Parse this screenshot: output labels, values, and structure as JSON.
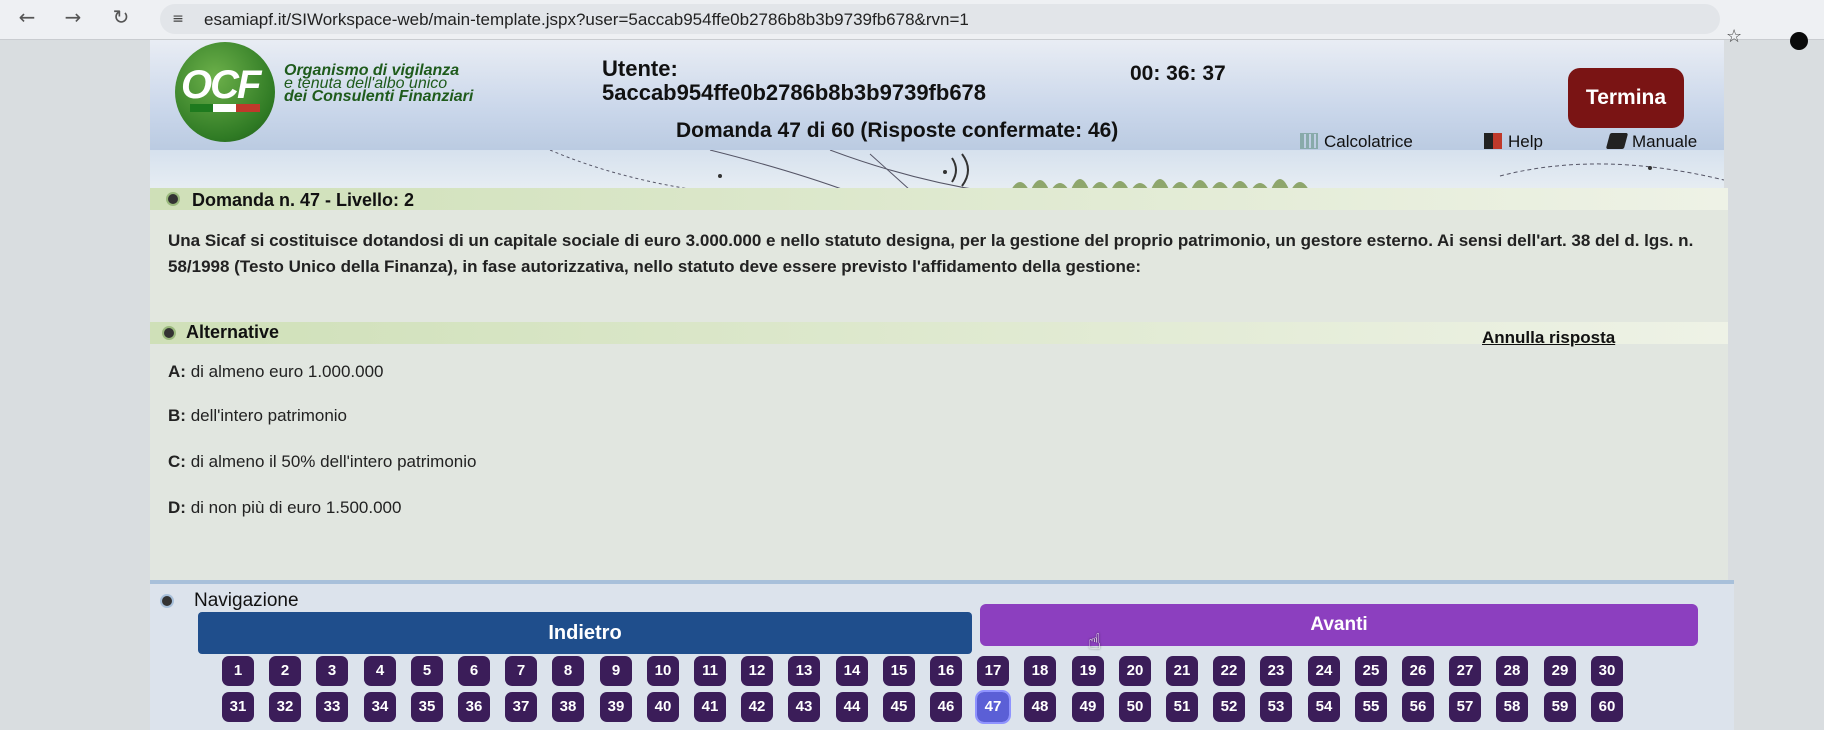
{
  "browser": {
    "url": "esamiapf.it/SIWorkspace-web/main-template.jspx?user=5accab954ffe0b2786b8b3b9739fb678&rvn=1"
  },
  "header": {
    "logo_text": "OCF",
    "org_line1": "Organismo di vigilanza",
    "org_line2": "e tenuta dell'albo unico",
    "org_line3": "dei Consulenti Finanziari",
    "user_label": "Utente:",
    "user_id": "5accab954ffe0b2786b8b3b9739fb678",
    "timer": "00: 36: 37",
    "question_status": "Domanda 47 di 60 (Risposte confermate: 46)",
    "terminate_label": "Termina",
    "tools": {
      "calculator": "Calcolatrice",
      "help": "Help",
      "manual": "Manuale"
    }
  },
  "question": {
    "title": "Domanda n. 47 - Livello: 2",
    "text": "Una Sicaf si costituisce dotandosi di un capitale sociale di euro 3.000.000 e nello statuto designa, per la gestione del proprio patrimonio, un gestore esterno. Ai sensi dell'art. 38 del d. lgs. n. 58/1998 (Testo Unico della Finanza), in fase autorizzativa, nello statuto deve essere previsto l'affidamento della gestione:"
  },
  "alternatives": {
    "title": "Alternative",
    "cancel_label": "Annulla risposta",
    "options": [
      {
        "letter": "A:",
        "text": "di almeno euro 1.000.000"
      },
      {
        "letter": "B:",
        "text": "dell'intero patrimonio"
      },
      {
        "letter": "C:",
        "text": "di almeno il 50% dell'intero patrimonio"
      },
      {
        "letter": "D:",
        "text": "di non più di euro 1.500.000"
      }
    ]
  },
  "navigation": {
    "title": "Navigazione",
    "back_label": "Indietro",
    "next_label": "Avanti",
    "current_question": "47",
    "question_numbers": [
      "1",
      "2",
      "3",
      "4",
      "5",
      "6",
      "7",
      "8",
      "9",
      "10",
      "11",
      "12",
      "13",
      "14",
      "15",
      "16",
      "17",
      "18",
      "19",
      "20",
      "21",
      "22",
      "23",
      "24",
      "25",
      "26",
      "27",
      "28",
      "29",
      "30",
      "31",
      "32",
      "33",
      "34",
      "35",
      "36",
      "37",
      "38",
      "39",
      "40",
      "41",
      "42",
      "43",
      "44",
      "45",
      "46",
      "47",
      "48",
      "49",
      "50",
      "51",
      "52",
      "53",
      "54",
      "55",
      "56",
      "57",
      "58",
      "59",
      "60"
    ]
  },
  "colors": {
    "terminate": "#7a1414",
    "back": "#1f4e8c",
    "next": "#8c3fbf",
    "question_button": "#3b1d59",
    "current_question_button": "#5b5fd6"
  }
}
